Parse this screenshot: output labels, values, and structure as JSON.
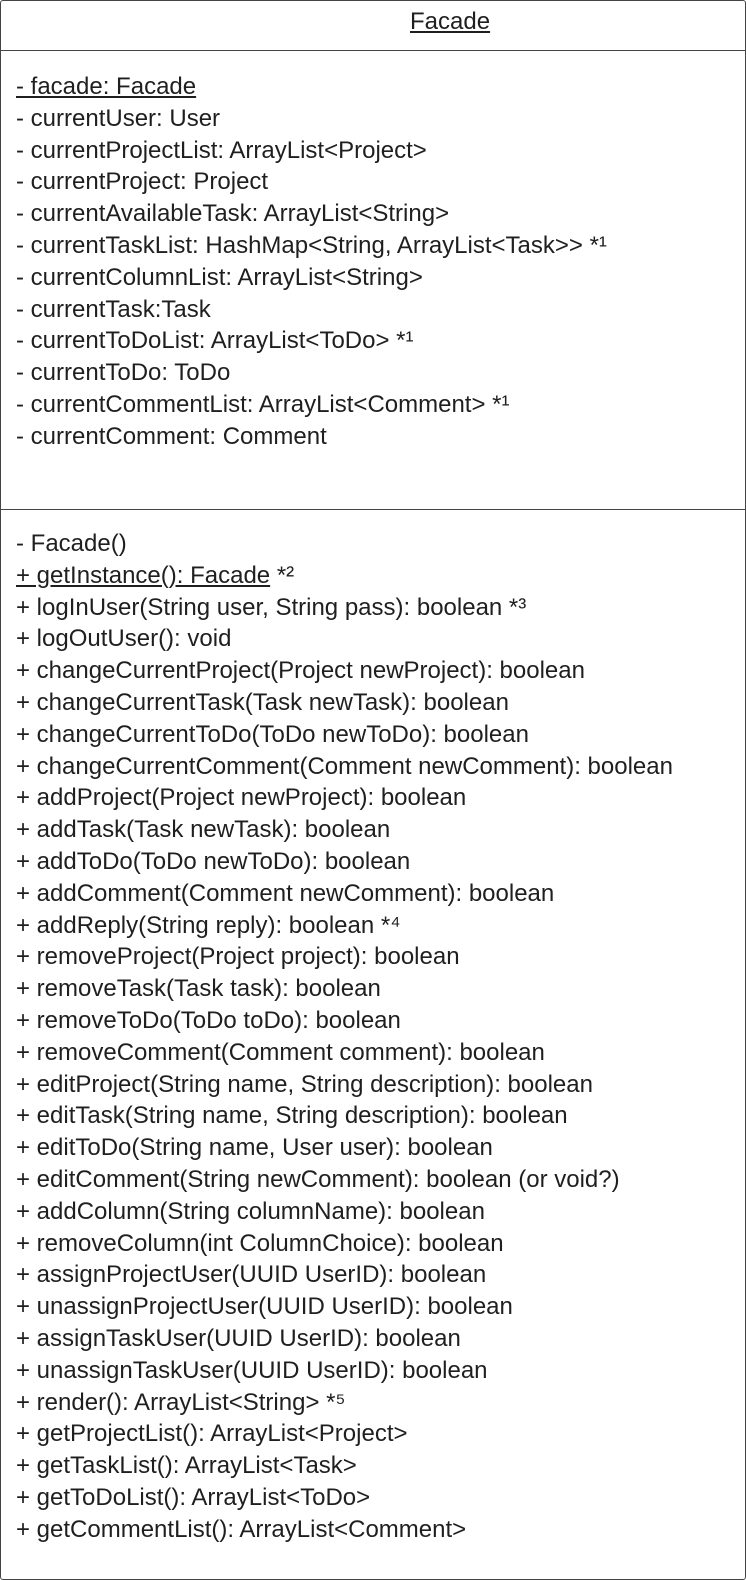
{
  "class": {
    "name": "Facade",
    "attributes": [
      {
        "text": "- facade: Facade",
        "static": true,
        "note": ""
      },
      {
        "text": "- currentUser: User",
        "static": false,
        "note": ""
      },
      {
        "text": "- currentProjectList: ArrayList<Project>",
        "static": false,
        "note": ""
      },
      {
        "text": "- currentProject: Project",
        "static": false,
        "note": ""
      },
      {
        "text": "- currentAvailableTask: ArrayList<String>",
        "static": false,
        "note": ""
      },
      {
        "text": "- currentTaskList: HashMap<String, ArrayList<Task>>",
        "static": false,
        "note": " *¹"
      },
      {
        "text": "- currentColumnList: ArrayList<String>",
        "static": false,
        "note": ""
      },
      {
        "text": "- currentTask:Task",
        "static": false,
        "note": ""
      },
      {
        "text": "- currentToDoList: ArrayList<ToDo>",
        "static": false,
        "note": " *¹"
      },
      {
        "text": "- currentToDo: ToDo",
        "static": false,
        "note": ""
      },
      {
        "text": "- currentCommentList: ArrayList<Comment>",
        "static": false,
        "note": " *¹"
      },
      {
        "text": "- currentComment: Comment",
        "static": false,
        "note": ""
      }
    ],
    "operations": [
      {
        "text": "- Facade()",
        "static": false,
        "note": ""
      },
      {
        "text": "+ getInstance(): Facade",
        "static": true,
        "note": " *²"
      },
      {
        "text": "+ logInUser(String user, String pass): boolean",
        "static": false,
        "note": " *³"
      },
      {
        "text": "+ logOutUser(): void",
        "static": false,
        "note": ""
      },
      {
        "text": "+ changeCurrentProject(Project newProject): boolean",
        "static": false,
        "note": ""
      },
      {
        "text": "+ changeCurrentTask(Task newTask): boolean",
        "static": false,
        "note": ""
      },
      {
        "text": "+ changeCurrentToDo(ToDo newToDo): boolean",
        "static": false,
        "note": ""
      },
      {
        "text": "+ changeCurrentComment(Comment newComment): boolean",
        "static": false,
        "note": ""
      },
      {
        "text": "+ addProject(Project newProject): boolean",
        "static": false,
        "note": ""
      },
      {
        "text": "+ addTask(Task newTask): boolean",
        "static": false,
        "note": ""
      },
      {
        "text": "+ addToDo(ToDo newToDo): boolean",
        "static": false,
        "note": ""
      },
      {
        "text": "+ addComment(Comment newComment): boolean",
        "static": false,
        "note": ""
      },
      {
        "text": "+ addReply(String reply): boolean",
        "static": false,
        "note": " *⁴"
      },
      {
        "text": "+ removeProject(Project project): boolean",
        "static": false,
        "note": ""
      },
      {
        "text": "+ removeTask(Task task): boolean",
        "static": false,
        "note": ""
      },
      {
        "text": "+ removeToDo(ToDo toDo): boolean",
        "static": false,
        "note": ""
      },
      {
        "text": "+ removeComment(Comment comment): boolean",
        "static": false,
        "note": ""
      },
      {
        "text": "+ editProject(String name, String description): boolean",
        "static": false,
        "note": ""
      },
      {
        "text": "+ editTask(String name, String description): boolean",
        "static": false,
        "note": ""
      },
      {
        "text": "+ editToDo(String name, User user): boolean",
        "static": false,
        "note": ""
      },
      {
        "text": "+ editComment(String newComment): boolean (or void?)",
        "static": false,
        "note": ""
      },
      {
        "text": "+ addColumn(String columnName): boolean",
        "static": false,
        "note": ""
      },
      {
        "text": "+ removeColumn(int ColumnChoice): boolean",
        "static": false,
        "note": ""
      },
      {
        "text": "+ assignProjectUser(UUID UserID): boolean",
        "static": false,
        "note": ""
      },
      {
        "text": "+ unassignProjectUser(UUID UserID): boolean",
        "static": false,
        "note": ""
      },
      {
        "text": "+ assignTaskUser(UUID UserID): boolean",
        "static": false,
        "note": ""
      },
      {
        "text": "+ unassignTaskUser(UUID UserID): boolean",
        "static": false,
        "note": ""
      },
      {
        "text": "+ render(): ArrayList<String>",
        "static": false,
        "note": " *⁵"
      },
      {
        "text": "+ getProjectList(): ArrayList<Project>",
        "static": false,
        "note": ""
      },
      {
        "text": "+ getTaskList(): ArrayList<Task>",
        "static": false,
        "note": ""
      },
      {
        "text": "+ getToDoList(): ArrayList<ToDo>",
        "static": false,
        "note": ""
      },
      {
        "text": "+ getCommentList(): ArrayList<Comment>",
        "static": false,
        "note": ""
      }
    ]
  }
}
